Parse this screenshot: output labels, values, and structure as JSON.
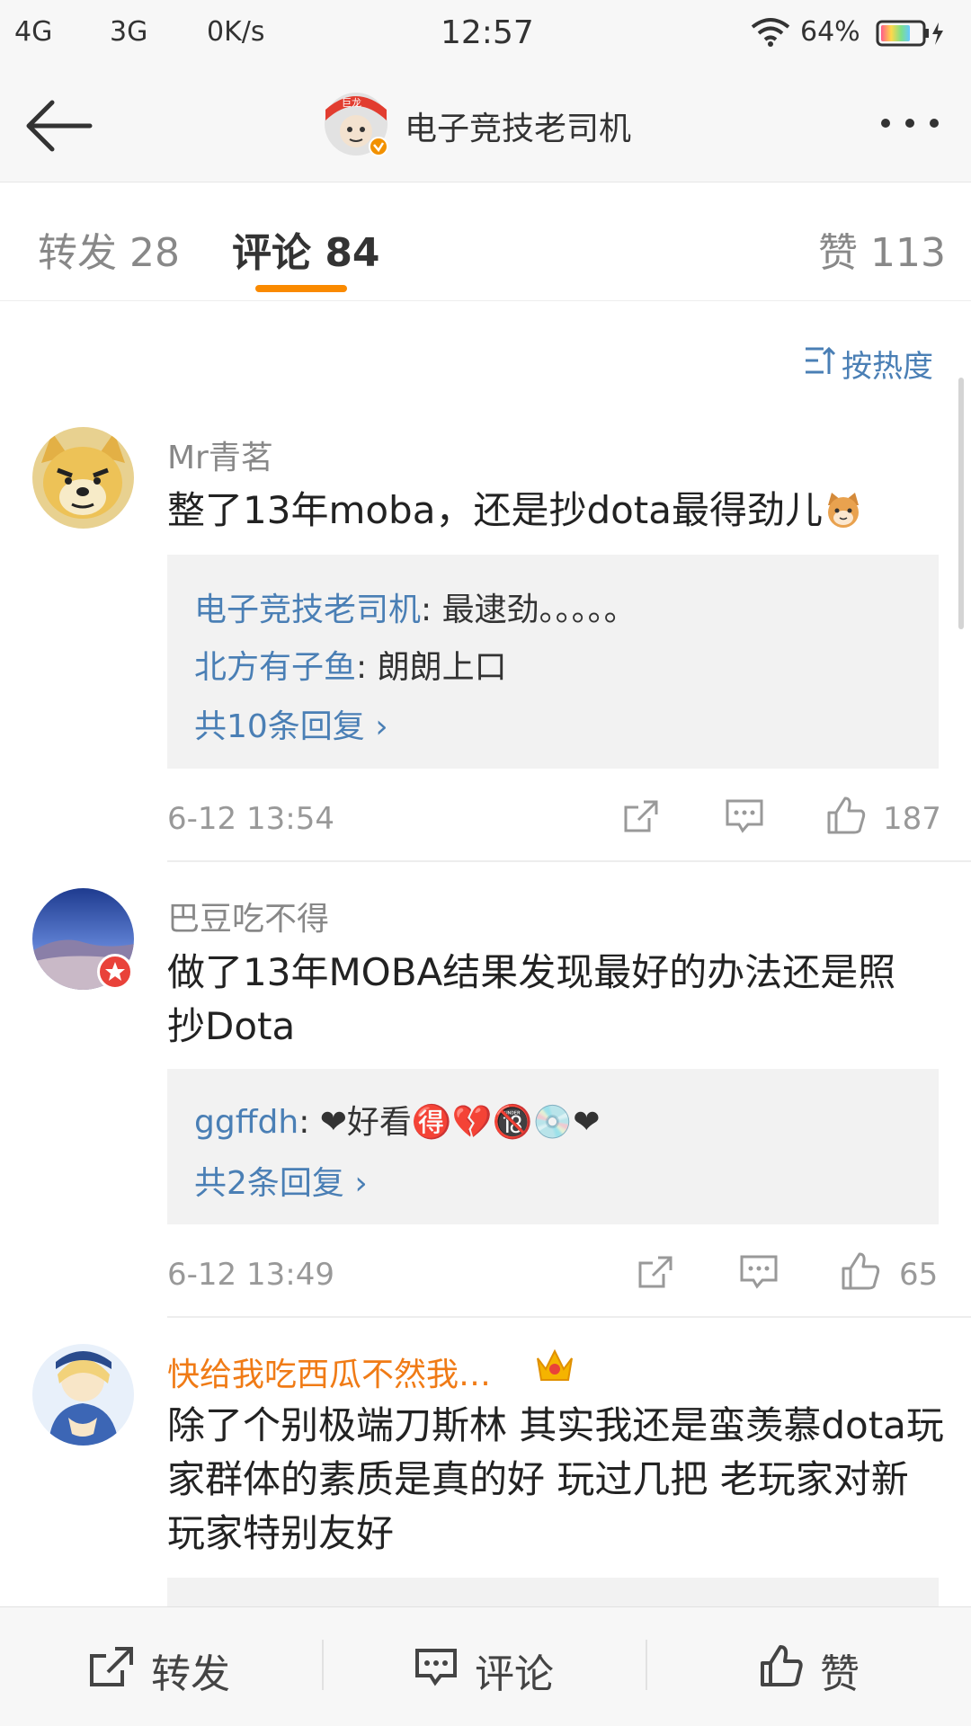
{
  "status_bar": {
    "net1": "4G",
    "net2": "3G",
    "speed": "0K/s",
    "time": "12:57",
    "battery": "64%"
  },
  "header": {
    "title": "电子竞技老司机",
    "avatar_badge_text": "巨龙"
  },
  "tabs": [
    {
      "label": "转发 28"
    },
    {
      "label": "评论 84"
    },
    {
      "label": "赞 113"
    }
  ],
  "sort_label": "按热度",
  "comments": [
    {
      "name": "Mr青茗",
      "text": "整了13年moba，还是抄dota最得劲儿",
      "replies": [
        {
          "name": "电子竞技老司机",
          "text": ": 最逮劲。。。。。"
        },
        {
          "name": "北方有子鱼",
          "text": ": 朗朗上口"
        }
      ],
      "more_label": "共10条回复 ›",
      "time": "6-12 13:54",
      "likes": "187"
    },
    {
      "name": "巴豆吃不得",
      "text": "做了13年MOBA结果发现最好的办法还是照抄Dota",
      "replies": [
        {
          "name": "ggffdh",
          "text": ": ❤好看🉐💔🔞💿❤"
        }
      ],
      "more_label": "共2条回复 ›",
      "time": "6-12 13:49",
      "likes": "65"
    },
    {
      "name": "快给我吃西瓜不然我…",
      "text": "除了个别极端刀斯林 其实我还是蛮羡慕dota玩家群体的素质是真的好 玩过几把 老玩家对新玩家特别友好"
    }
  ],
  "bottom_bar": {
    "repost": "转发",
    "comment": "评论",
    "like": "赞"
  },
  "colors": {
    "accent": "#fa8a00",
    "link": "#4a7fb5",
    "vip_name": "#f07b16"
  }
}
